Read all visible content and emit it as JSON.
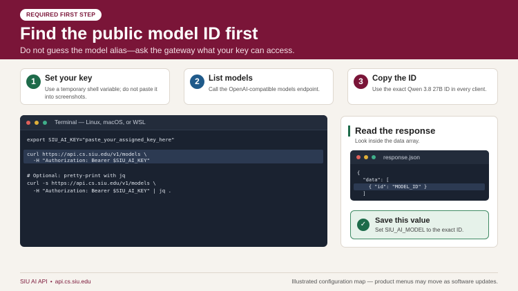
{
  "header": {
    "badge": "REQUIRED FIRST STEP",
    "title": "Find the public model ID first",
    "subtitle": "Do not guess the model alias—ask the gateway what your key can access."
  },
  "steps": [
    {
      "number": "1",
      "title": "Set your key",
      "description": "Use a temporary shell variable; do not paste it into screenshots.",
      "color": "#1e6b4a"
    },
    {
      "number": "2",
      "title": "List models",
      "description": "Call the OpenAI-compatible models endpoint.",
      "color": "#1f5a8a"
    },
    {
      "number": "3",
      "title": "Copy the ID",
      "description": "Use the exact Qwen 3.8 27B ID in every client.",
      "color": "#7a1538"
    }
  ],
  "terminal": {
    "title": "Terminal — Linux, macOS, or WSL",
    "lines": [
      "export SIU_AI_KEY=\"paste_your_assigned_key_here\"",
      "",
      "curl https://api.cs.siu.edu/v1/models \\",
      "  -H \"Authorization: Bearer $SIU_AI_KEY\"",
      "",
      "# Optional: pretty-print with jq",
      "curl -s https://api.cs.siu.edu/v1/models \\",
      "  -H \"Authorization: Bearer $SIU_AI_KEY\" | jq ."
    ]
  },
  "response_panel": {
    "title": "Read the response",
    "subtitle": "Look inside the data array.",
    "file_title": "response.json",
    "json_lines": [
      "{",
      "  \"data\": [",
      "    { \"id\": \"MODEL_ID\" }",
      "  ]"
    ],
    "save_title": "Save this value",
    "save_desc": "Set SIU_AI_MODEL to the exact ID."
  },
  "footer": {
    "brand": "SIU AI API",
    "separator": "•",
    "domain": "api.cs.siu.edu",
    "note": "Illustrated configuration map — product menus may move as software updates."
  },
  "colors": {
    "brand": "#7a1538",
    "green": "#1e6b4a",
    "blue": "#1f5a8a",
    "terminal_bg": "#1a2230",
    "dot_red": "#e0605a",
    "dot_yellow": "#e0b03a",
    "dot_green": "#3fae8a"
  },
  "icons": {
    "save": "check-icon"
  }
}
